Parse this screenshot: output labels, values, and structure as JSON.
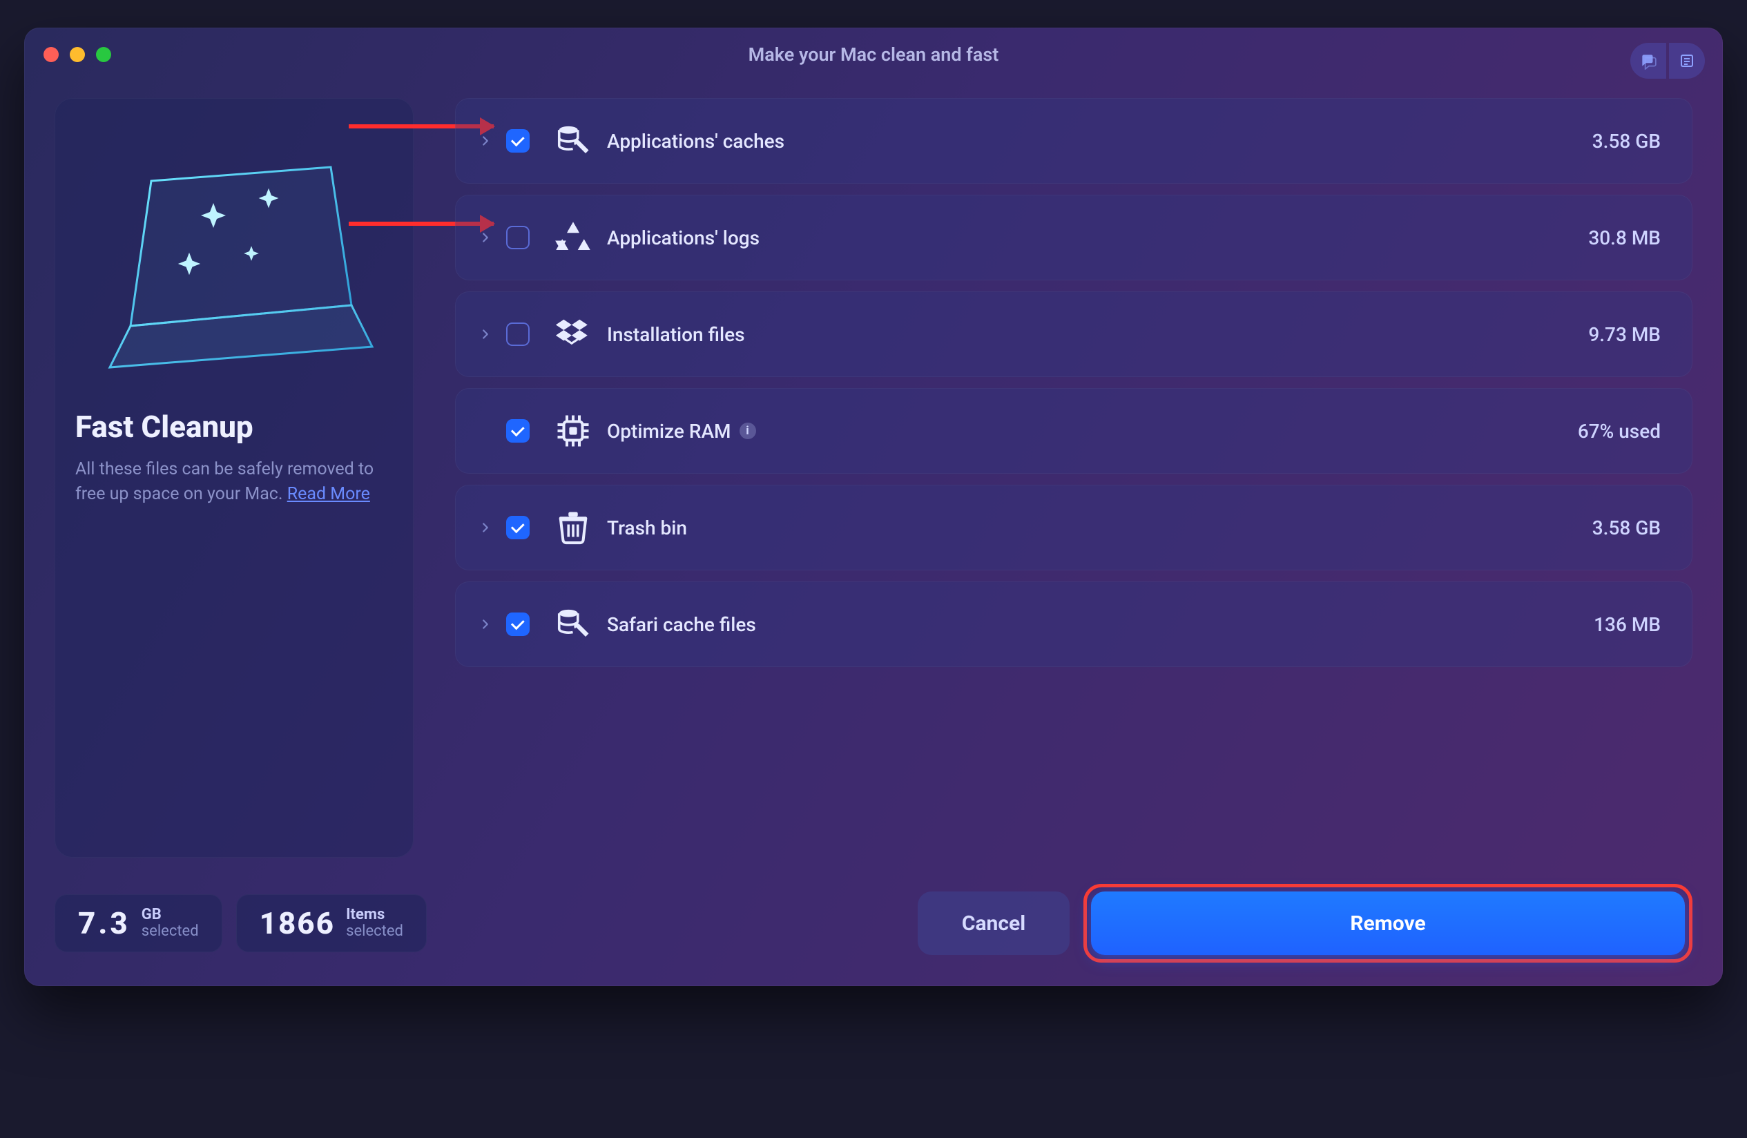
{
  "header": {
    "title": "Make your Mac clean and fast"
  },
  "sidebar": {
    "heading": "Fast Cleanup",
    "description_prefix": "All these files can be safely removed to free up space on your Mac. ",
    "read_more": "Read More"
  },
  "rows": [
    {
      "label": "Applications' caches",
      "size": "3.58 GB",
      "checked": true,
      "expandable": true,
      "icon": "db-brush",
      "info": false
    },
    {
      "label": "Applications' logs",
      "size": "30.8 MB",
      "checked": false,
      "expandable": true,
      "icon": "apps",
      "info": false
    },
    {
      "label": "Installation files",
      "size": "9.73 MB",
      "checked": false,
      "expandable": true,
      "icon": "dropbox",
      "info": false
    },
    {
      "label": "Optimize RAM",
      "size": "67% used",
      "checked": true,
      "expandable": false,
      "icon": "chip",
      "info": true
    },
    {
      "label": "Trash bin",
      "size": "3.58 GB",
      "checked": true,
      "expandable": true,
      "icon": "trash",
      "info": false
    },
    {
      "label": "Safari cache files",
      "size": "136 MB",
      "checked": true,
      "expandable": true,
      "icon": "db-brush",
      "info": false
    }
  ],
  "footer": {
    "size_value": "7.3",
    "size_unit": "GB",
    "size_caption": "selected",
    "items_value": "1866",
    "items_unit": "Items",
    "items_caption": "selected",
    "cancel": "Cancel",
    "remove": "Remove"
  }
}
